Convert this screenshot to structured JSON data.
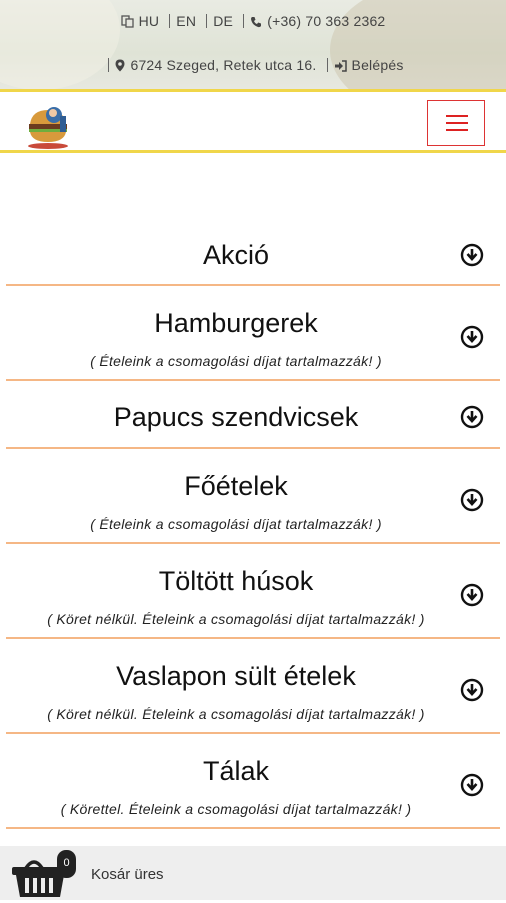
{
  "topbar": {
    "languages": [
      "HU",
      "EN",
      "DE"
    ],
    "phone": "(+36) 70 363 2362",
    "address": "6724 Szeged, Retek utca 16.",
    "login": "Belépés"
  },
  "colors": {
    "accent_yellow": "#f0d64a",
    "divider_orange": "#f5b785",
    "menu_red": "#d22222"
  },
  "categories": [
    {
      "title": "Akció",
      "note": ""
    },
    {
      "title": "Hamburgerek",
      "note": "( Ételeink a csomagolási díjat tartalmazzák! )"
    },
    {
      "title": "Papucs szendvicsek",
      "note": ""
    },
    {
      "title": "Főételek",
      "note": "( Ételeink a csomagolási díjat tartalmazzák! )"
    },
    {
      "title": "Töltött húsok",
      "note": "( Köret nélkül. Ételeink a csomagolási díjat tartalmazzák! )"
    },
    {
      "title": "Vaslapon sült ételek",
      "note": "( Köret nélkül. Ételeink a csomagolási díjat tartalmazzák! )"
    },
    {
      "title": "Tálak",
      "note": "( Körettel. Ételeink a csomagolási díjat tartalmazzák! )"
    }
  ],
  "cart": {
    "count": "0",
    "label": "Kosár üres"
  }
}
